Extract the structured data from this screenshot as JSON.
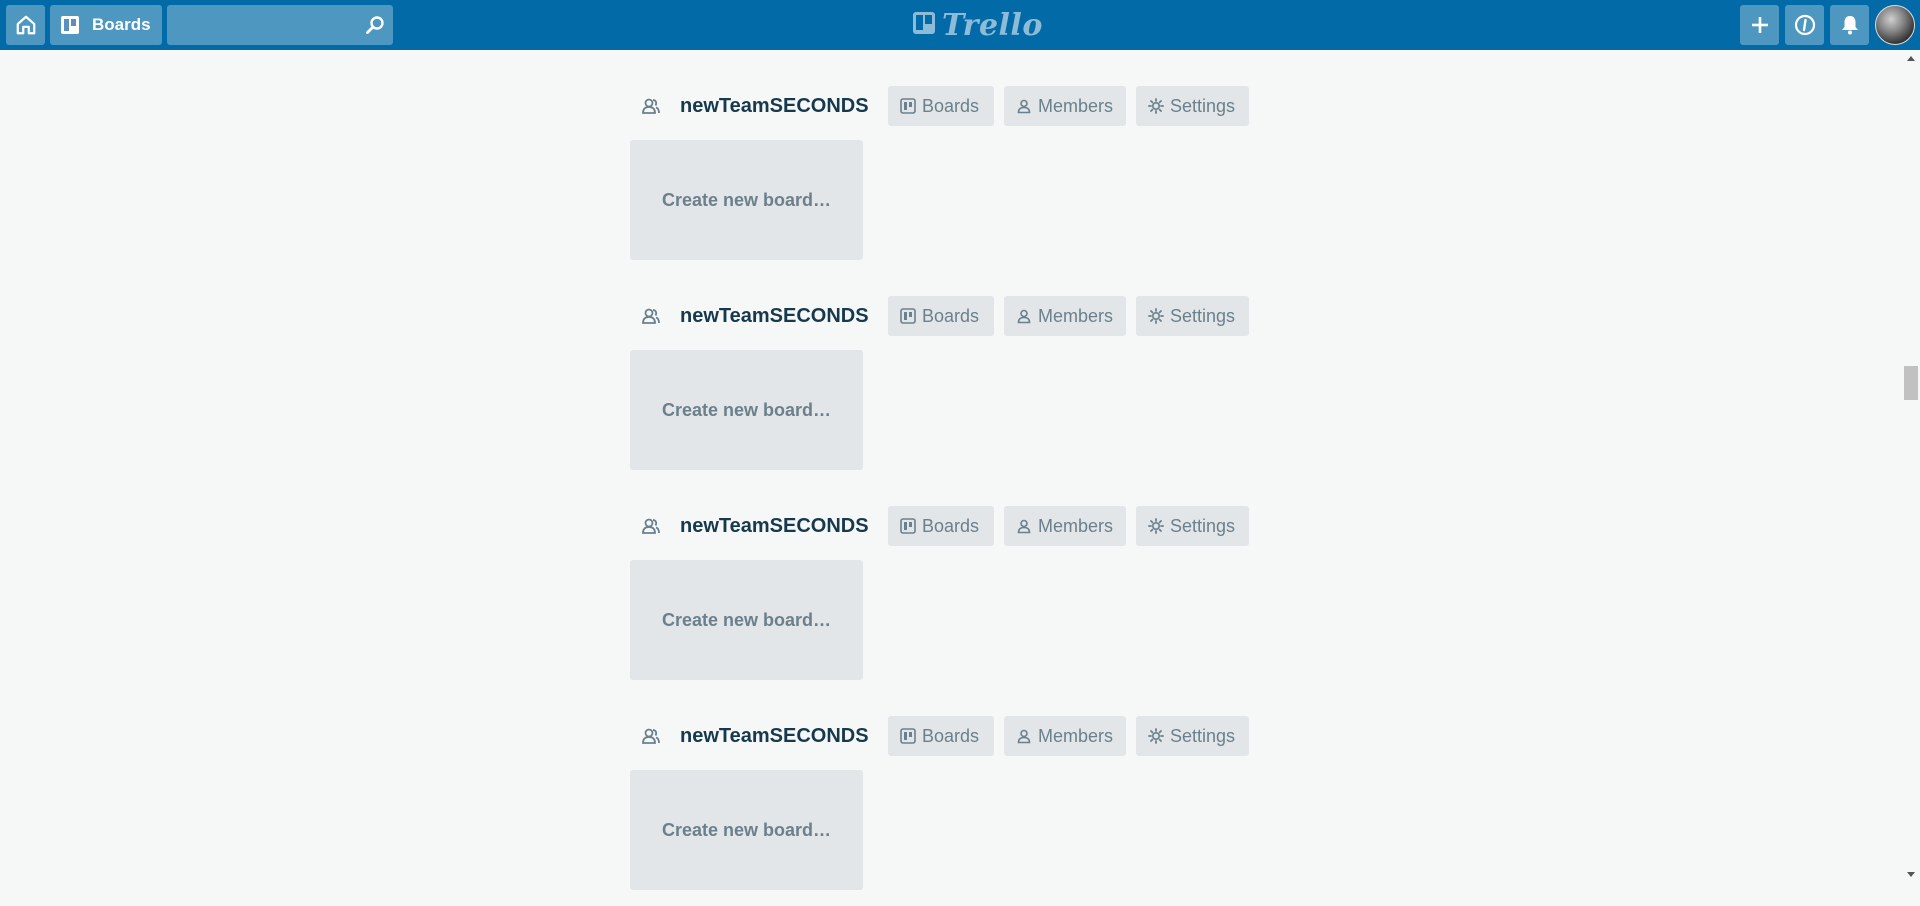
{
  "header": {
    "boards_label": "Boards",
    "search_value": "",
    "logo_text": "Trello",
    "icons": [
      "home-icon",
      "board-icon",
      "search-icon",
      "plus-icon",
      "info-icon",
      "bell-icon"
    ]
  },
  "teams": [
    {
      "name": "newTeamSECONDS",
      "boards_label": "Boards",
      "members_label": "Members",
      "settings_label": "Settings",
      "create_label": "Create new board…"
    },
    {
      "name": "newTeamSECONDS",
      "boards_label": "Boards",
      "members_label": "Members",
      "settings_label": "Settings",
      "create_label": "Create new board…"
    },
    {
      "name": "newTeamSECONDS",
      "boards_label": "Boards",
      "members_label": "Members",
      "settings_label": "Settings",
      "create_label": "Create new board…"
    },
    {
      "name": "newTeamSECONDS",
      "boards_label": "Boards",
      "members_label": "Members",
      "settings_label": "Settings",
      "create_label": "Create new board…"
    }
  ],
  "colors": {
    "header_bg": "#026aa7",
    "page_bg": "#f6f8f8",
    "team_name": "#17394d",
    "button_bg": "#e2e6e9",
    "button_text": "#6b808c"
  }
}
